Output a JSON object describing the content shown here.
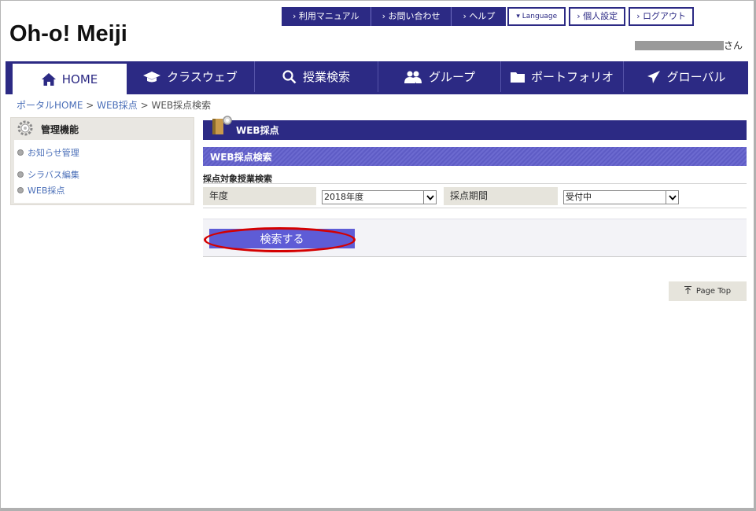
{
  "utility_links": {
    "manual": "› 利用マニュアル",
    "contact": "› お問い合わせ",
    "help": "› ヘルプ",
    "language": "▾ Language",
    "settings": "› 個人設定",
    "logout": "› ログアウト"
  },
  "logo": "Oh-o! Meiji",
  "user": {
    "suffix": "さん"
  },
  "nav": {
    "home": "HOME",
    "classweb": "クラスウェブ",
    "course_search": "授業検索",
    "group": "グループ",
    "portfolio": "ポートフォリオ",
    "global": "グローバル"
  },
  "breadcrumb": {
    "portal": "ポータルHOME",
    "sep1": " > ",
    "web_grading": "WEB採点",
    "sep2": " > ",
    "current": "WEB採点検索"
  },
  "sidebar": {
    "title": "管理機能",
    "items": [
      "お知らせ管理",
      "シラバス編集",
      "WEB採点"
    ]
  },
  "main": {
    "page_header": "WEB採点",
    "section_header": "WEB採点検索",
    "form_title": "採点対象授業検索",
    "year_label": "年度",
    "year_value": "2018年度",
    "period_label": "採点期間",
    "period_value": "受付中",
    "search_button": "検索する"
  },
  "page_top": "Page Top",
  "colors": {
    "brand": "#2c2a84",
    "button": "#5e5cd6",
    "highlight": "#d40000"
  }
}
